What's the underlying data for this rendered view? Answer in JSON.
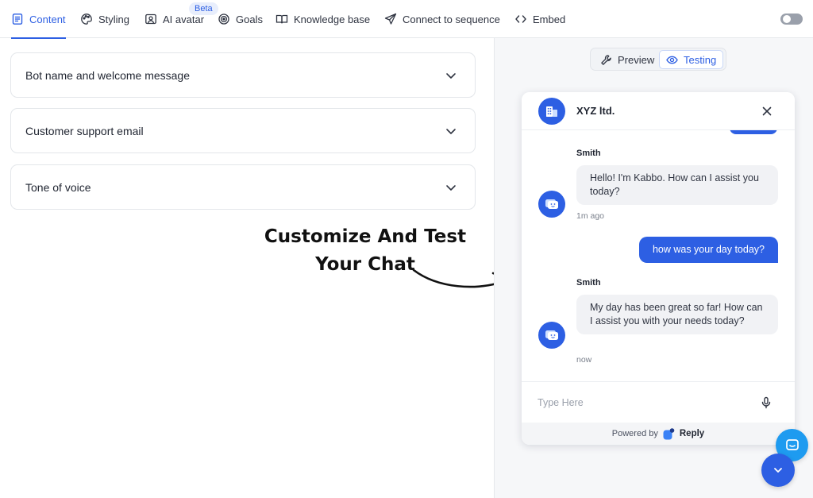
{
  "nav": {
    "tabs": [
      {
        "label": "Content",
        "icon": "document-lines-icon",
        "active": true
      },
      {
        "label": "Styling",
        "icon": "palette-icon"
      },
      {
        "label": "AI avatar",
        "icon": "portrait-icon"
      },
      {
        "label": "Goals",
        "icon": "target-icon"
      },
      {
        "label": "Knowledge base",
        "icon": "open-book-icon"
      },
      {
        "label": "Connect to sequence",
        "icon": "paper-plane-icon"
      },
      {
        "label": "Embed",
        "icon": "code-brackets-icon"
      }
    ],
    "beta_badge": "Beta",
    "toggle_on": false
  },
  "sections": [
    {
      "title": "Bot name and welcome message",
      "icon": "chevron-down-icon"
    },
    {
      "title": "Customer support email",
      "icon": "chevron-down-icon"
    },
    {
      "title": "Tone of voice",
      "icon": "chevron-down-icon"
    }
  ],
  "annotation": {
    "line1": "Customize And Test",
    "line2": "Your Chat"
  },
  "mode": {
    "preview_label": "Preview",
    "testing_label": "Testing",
    "active": "Testing"
  },
  "widget": {
    "company": "XYZ ltd.",
    "messages": [
      {
        "sender": "Smith",
        "text": "Hello! I'm Kabbo. How can I assist you today?",
        "time": "1m ago"
      },
      {
        "from_user": true,
        "text": "how was your day today?"
      },
      {
        "sender": "Smith",
        "text": "My day has been great so far! How can I assist you with your needs today?",
        "time": "now"
      }
    ],
    "input_placeholder": "Type Here",
    "powered_by": "Powered by",
    "brand": "Reply"
  },
  "colors": {
    "accent": "#2d5fe3",
    "chat_fab": "#1e9bf0",
    "panel_bg": "#f6f7f9"
  }
}
